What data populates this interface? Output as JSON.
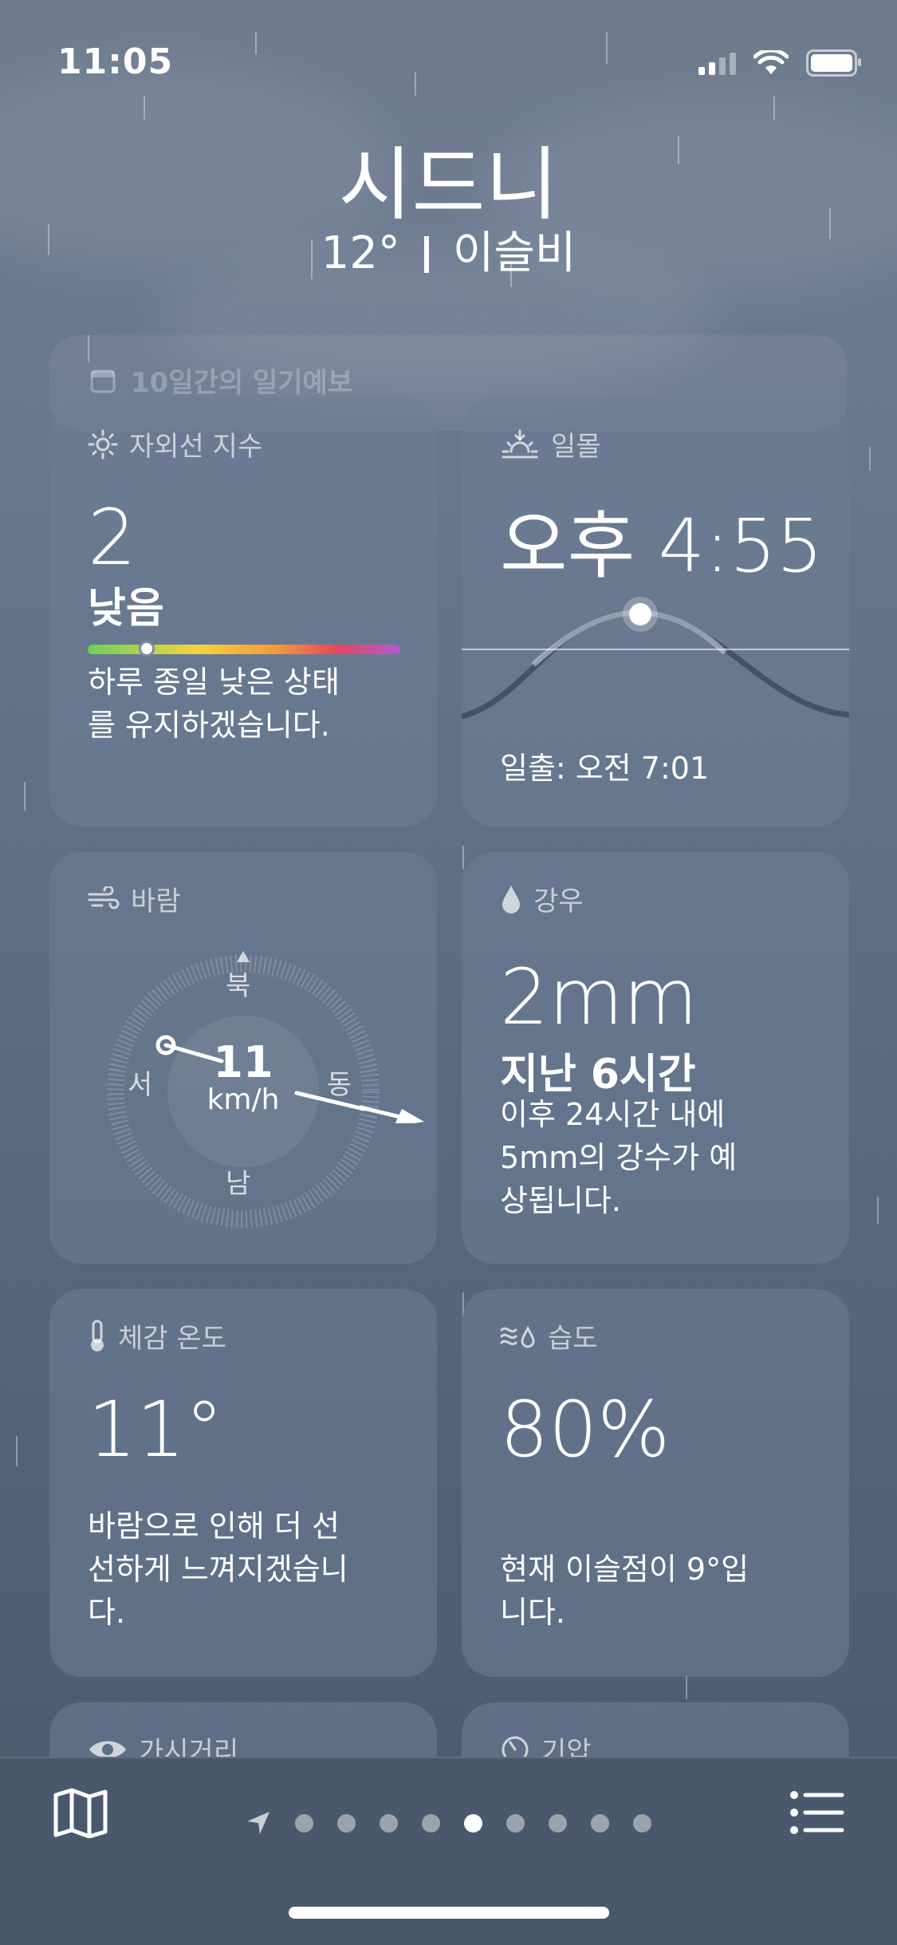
{
  "status_bar": {
    "time": "11:05"
  },
  "header": {
    "city": "시드니",
    "temperature": "12°",
    "condition": "이슬비"
  },
  "forecast_card": {
    "label": "10일간의 일기예보"
  },
  "uv": {
    "title": "자외선 지수",
    "value": "2",
    "level": "낮음",
    "level_fraction": 0.18,
    "description": "하루 종일 낮은 상태를 유지하겠습니다."
  },
  "sunset": {
    "title": "일몰",
    "time": "오후 4:55",
    "sunrise": "일출: 오전 7:01"
  },
  "wind": {
    "title": "바람",
    "speed": "11",
    "unit": "km/h",
    "north": "북",
    "east": "동",
    "south": "남",
    "west": "서"
  },
  "rain": {
    "title": "강우",
    "amount": "2mm",
    "period": "지난 6시간",
    "description": "이후 24시간 내에 5mm의 강수가 예상됩니다."
  },
  "feels_like": {
    "title": "체감 온도",
    "value": "11°",
    "description": "바람으로 인해 더 선선하게 느껴지겠습니다."
  },
  "humidity": {
    "title": "습도",
    "value": "80%",
    "description": "현재 이슬점이 9°입니다."
  },
  "visibility": {
    "title": "가시거리"
  },
  "pressure": {
    "title": "기압"
  },
  "tab_bar": {
    "page_count": 9,
    "active_page": 5
  }
}
